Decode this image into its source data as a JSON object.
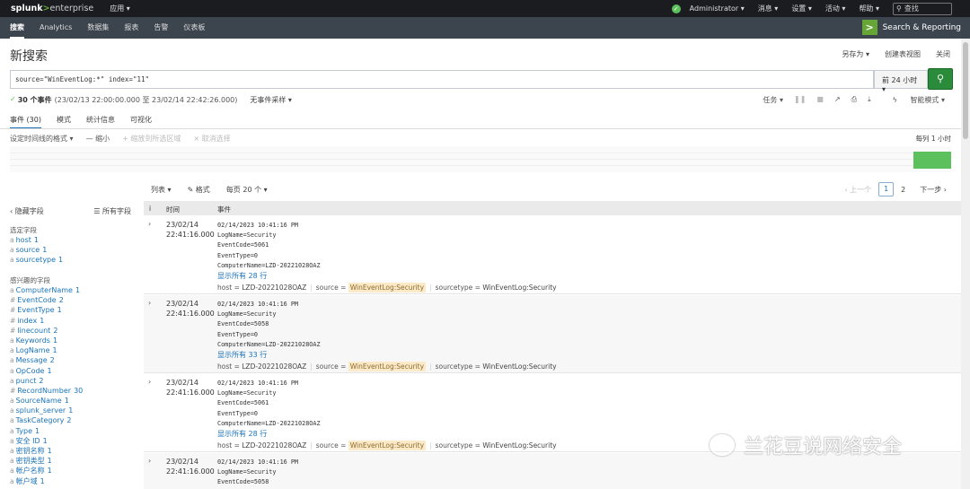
{
  "topbar": {
    "logo_a": "splunk",
    "logo_gt": ">",
    "logo_b": "enterprise",
    "apps": "应用 ▾",
    "menus": [
      "Administrator ▾",
      "消息 ▾",
      "设置 ▾",
      "活动 ▾",
      "帮助 ▾"
    ],
    "search_placeholder": "查找"
  },
  "appbar": {
    "tabs": [
      "搜索",
      "Analytics",
      "数据集",
      "报表",
      "告警",
      "仪表板"
    ],
    "brand": "Search & Reporting"
  },
  "page": {
    "title": "新搜索",
    "actions": [
      "另存为 ▾",
      "创建表视图",
      "关闭"
    ]
  },
  "search": {
    "query": "source=\"WinEventLog:*\" index=\"11\"",
    "timerange": "前 24 小时 ▾"
  },
  "status": {
    "count": "30 个事件",
    "range": "(23/02/13 22:00:00.000 至 23/02/14 22:42:26.000)",
    "sampling": "无事件采样 ▾",
    "job": "任务 ▾",
    "mode": "智能模式 ▾"
  },
  "tabs": [
    "事件 (30)",
    "模式",
    "统计信息",
    "可视化"
  ],
  "timeline": {
    "format": "设定时间线的格式 ▾",
    "zoom_out": "— 缩小",
    "zoom_sel": "+ 缩放到所选区域",
    "deselect": "× 取消选择",
    "scale": "每列 1 小时"
  },
  "results": {
    "list": "列表 ▾",
    "format": "✎ 格式",
    "perpage": "每页 20 个 ▾",
    "prev": "‹ 上一个",
    "page1": "1",
    "page2": "2",
    "next": "下一步 ›"
  },
  "sidebar": {
    "hide": "‹ 隐藏字段",
    "all": "☰ 所有字段",
    "selected_title": "选定字段",
    "selected": [
      {
        "type": "a",
        "name": "host",
        "count": "1"
      },
      {
        "type": "a",
        "name": "source",
        "count": "1"
      },
      {
        "type": "a",
        "name": "sourcetype",
        "count": "1"
      }
    ],
    "interesting_title": "感兴趣的字段",
    "interesting": [
      {
        "type": "a",
        "name": "ComputerName",
        "count": "1"
      },
      {
        "type": "#",
        "name": "EventCode",
        "count": "2"
      },
      {
        "type": "#",
        "name": "EventType",
        "count": "1"
      },
      {
        "type": "#",
        "name": "index",
        "count": "1"
      },
      {
        "type": "#",
        "name": "linecount",
        "count": "2"
      },
      {
        "type": "a",
        "name": "Keywords",
        "count": "1"
      },
      {
        "type": "a",
        "name": "LogName",
        "count": "1"
      },
      {
        "type": "a",
        "name": "Message",
        "count": "2"
      },
      {
        "type": "a",
        "name": "OpCode",
        "count": "1"
      },
      {
        "type": "a",
        "name": "punct",
        "count": "2"
      },
      {
        "type": "#",
        "name": "RecordNumber",
        "count": "30"
      },
      {
        "type": "a",
        "name": "SourceName",
        "count": "1"
      },
      {
        "type": "a",
        "name": "splunk_server",
        "count": "1"
      },
      {
        "type": "a",
        "name": "TaskCategory",
        "count": "2"
      },
      {
        "type": "a",
        "name": "Type",
        "count": "1"
      },
      {
        "type": "a",
        "name": "安全 ID",
        "count": "1"
      },
      {
        "type": "a",
        "name": "密钥名称",
        "count": "1"
      },
      {
        "type": "a",
        "name": "密钥类型",
        "count": "1"
      },
      {
        "type": "a",
        "name": "帐户名称",
        "count": "1"
      },
      {
        "type": "a",
        "name": "帐户域",
        "count": "1"
      }
    ]
  },
  "table": {
    "col_i": "i",
    "col_time": "时间",
    "col_event": "事件"
  },
  "events": [
    {
      "date": "23/02/14",
      "time": "22:41:16.000",
      "lines": [
        "02/14/2023 10:41:16 PM",
        "LogName=Security",
        "EventCode=5061",
        "EventType=0",
        "ComputerName=LZD-20221028OAZ"
      ],
      "more": "显示所有 28 行",
      "host": "LZD-20221028OAZ",
      "source": "WinEventLog:Security",
      "sourcetype": "WinEventLog:Security"
    },
    {
      "date": "23/02/14",
      "time": "22:41:16.000",
      "lines": [
        "02/14/2023 10:41:16 PM",
        "LogName=Security",
        "EventCode=5058",
        "EventType=0",
        "ComputerName=LZD-20221028OAZ"
      ],
      "more": "显示所有 33 行",
      "host": "LZD-20221028OAZ",
      "source": "WinEventLog:Security",
      "sourcetype": "WinEventLog:Security"
    },
    {
      "date": "23/02/14",
      "time": "22:41:16.000",
      "lines": [
        "02/14/2023 10:41:16 PM",
        "LogName=Security",
        "EventCode=5061",
        "EventType=0",
        "ComputerName=LZD-20221028OAZ"
      ],
      "more": "显示所有 28 行",
      "host": "LZD-20221028OAZ",
      "source": "WinEventLog:Security",
      "sourcetype": "WinEventLog:Security"
    },
    {
      "date": "23/02/14",
      "time": "22:41:16.000",
      "lines": [
        "02/14/2023 10:41:16 PM",
        "LogName=Security",
        "EventCode=5058"
      ],
      "more": "",
      "host": "",
      "source": "",
      "sourcetype": ""
    }
  ],
  "watermark": "兰花豆说网络安全",
  "colors": {
    "accent": "#65a637",
    "link": "#1a73b8",
    "highlight": "#fbe9c8"
  }
}
